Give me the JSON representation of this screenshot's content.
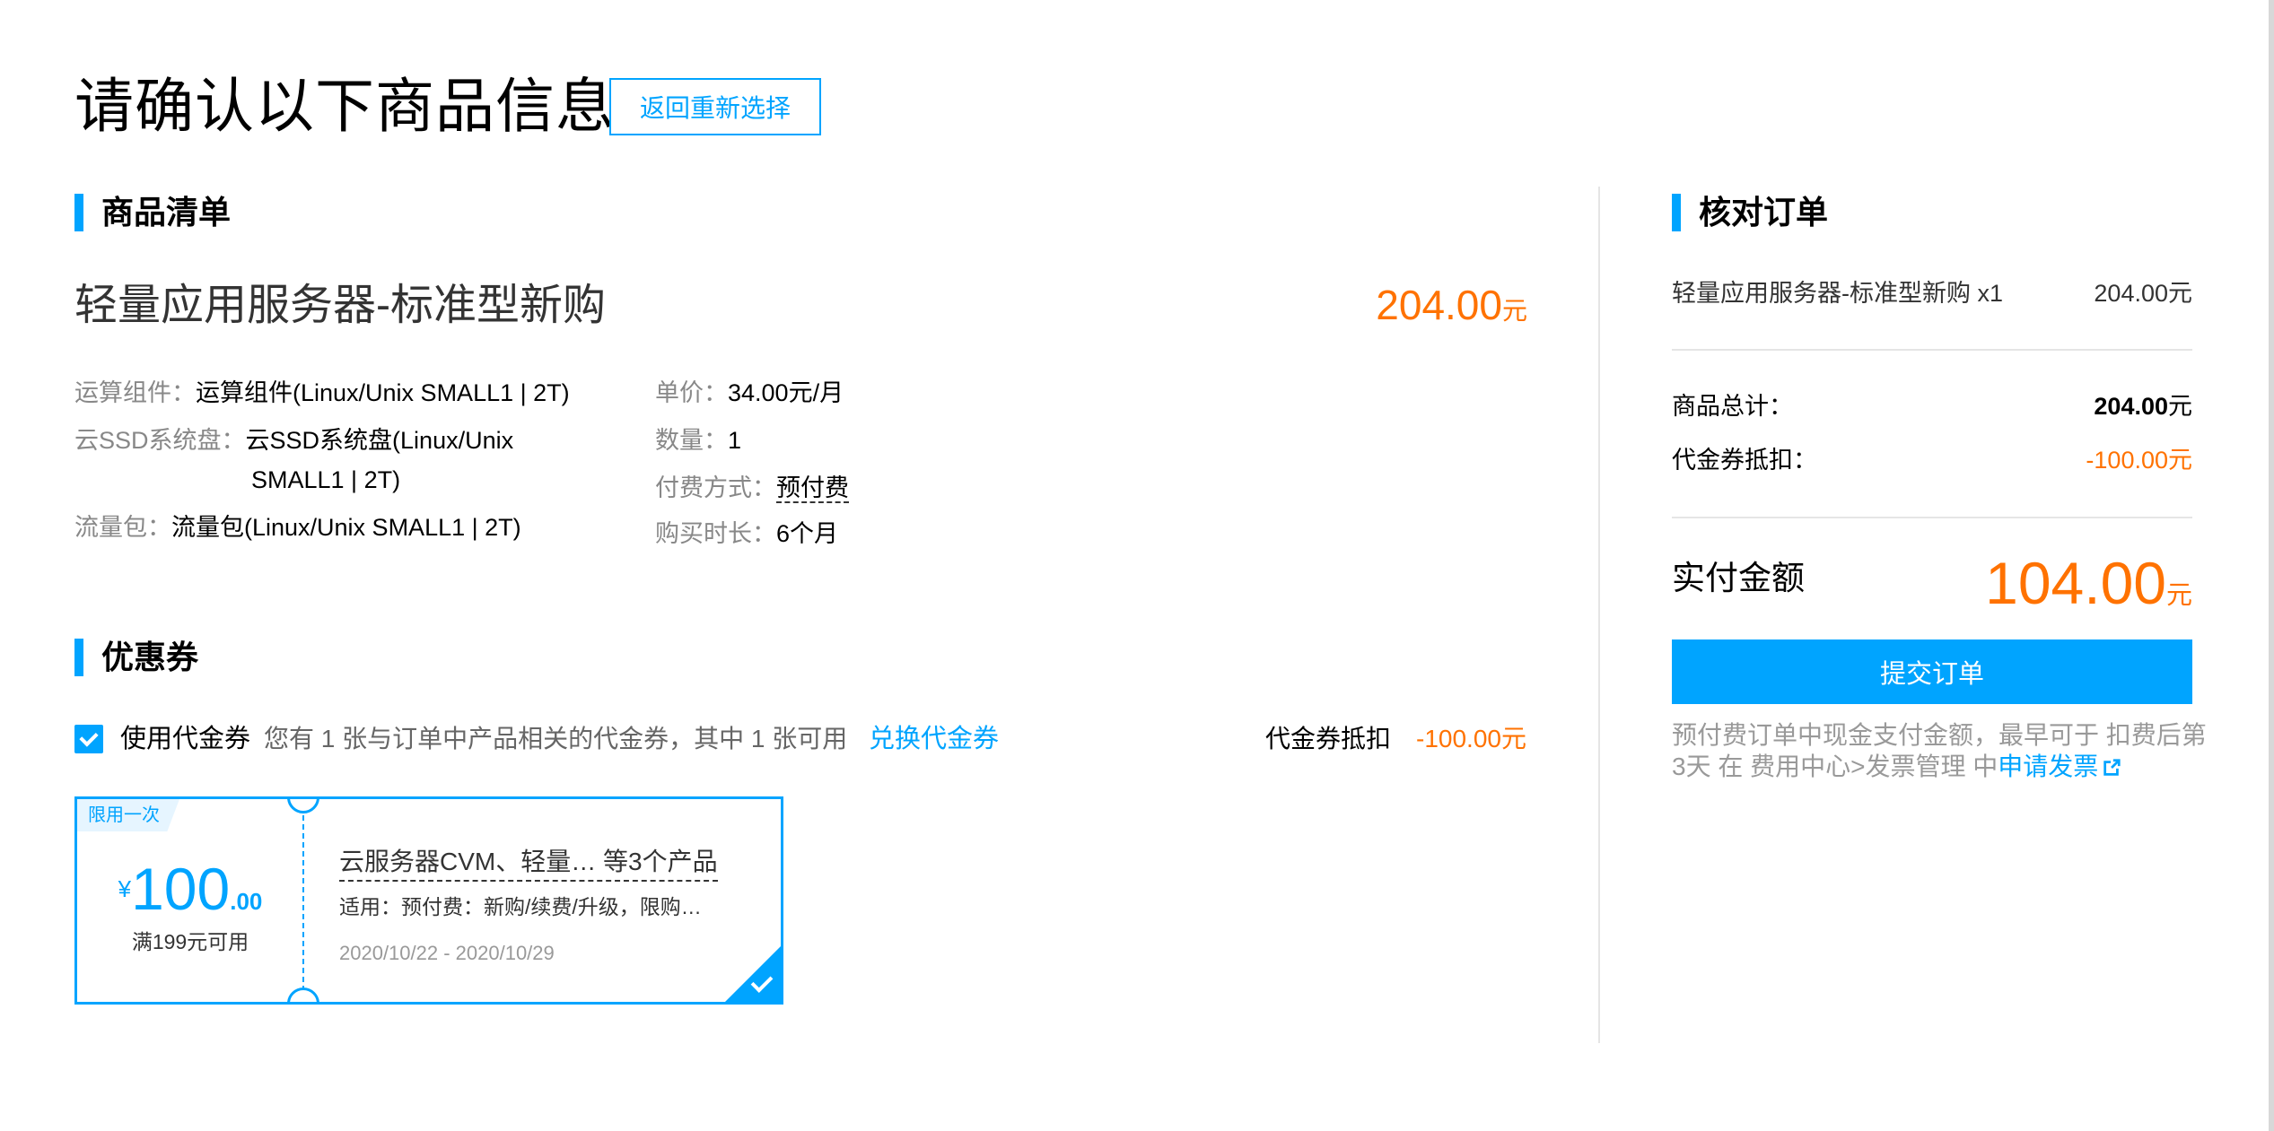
{
  "header": {
    "title": "请确认以下商品信息",
    "back_button": "返回重新选择"
  },
  "goods": {
    "section_title": "商品清单",
    "product_name": "轻量应用服务器-标准型新购",
    "price": "204.00",
    "price_unit": "元",
    "specs_left": [
      {
        "label": "运算组件：",
        "value": "运算组件(Linux/Unix SMALL1 | 2T)"
      },
      {
        "label": "云SSD系统盘：",
        "value": "云SSD系统盘(Linux/Unix",
        "value2": "SMALL1 | 2T)"
      },
      {
        "label": "流量包：",
        "value": "流量包(Linux/Unix SMALL1 | 2T)"
      }
    ],
    "specs_right": [
      {
        "label": "单价：",
        "value": "34.00元/月"
      },
      {
        "label": "数量：",
        "value": "1"
      },
      {
        "label": "付费方式：",
        "value": "预付费"
      },
      {
        "label": "购买时长：",
        "value": "6个月"
      }
    ]
  },
  "coupon_section": {
    "section_title": "优惠券",
    "use_coupon_label": "使用代金券",
    "use_coupon_checked": true,
    "info_text": "您有 1 张与订单中产品相关的代金券，其中 1 张可用",
    "exchange_link": "兑换代金券",
    "deduct_label": "代金券抵扣",
    "deduct_value": "-100.00元",
    "card": {
      "tag": "限用一次",
      "currency": "¥",
      "amount_int": "100",
      "amount_dec": ".00",
      "condition": "满199元可用",
      "title": "云服务器CVM、轻量… 等3个产品",
      "scope": "适用：预付费：新购/续费/升级，限购…",
      "date": "2020/10/22 - 2020/10/29"
    }
  },
  "order": {
    "section_title": "核对订单",
    "item_name": "轻量应用服务器-标准型新购 x1",
    "item_price": "204.00元",
    "total_label": "商品总计：",
    "total_value": "204.00",
    "total_unit": "元",
    "voucher_label": "代金券抵扣：",
    "voucher_value": "-100.00元",
    "pay_label": "实付金额",
    "pay_value": "104.00",
    "pay_unit": "元",
    "submit_button": "提交订单",
    "note_text": "预付费订单中现金支付金额，最早可于 扣费后第3天 在 费用中心>发票管理 中",
    "note_link": "申请发票"
  },
  "colors": {
    "accent": "#00a4ff",
    "price": "#ff7200",
    "muted": "#888888"
  }
}
